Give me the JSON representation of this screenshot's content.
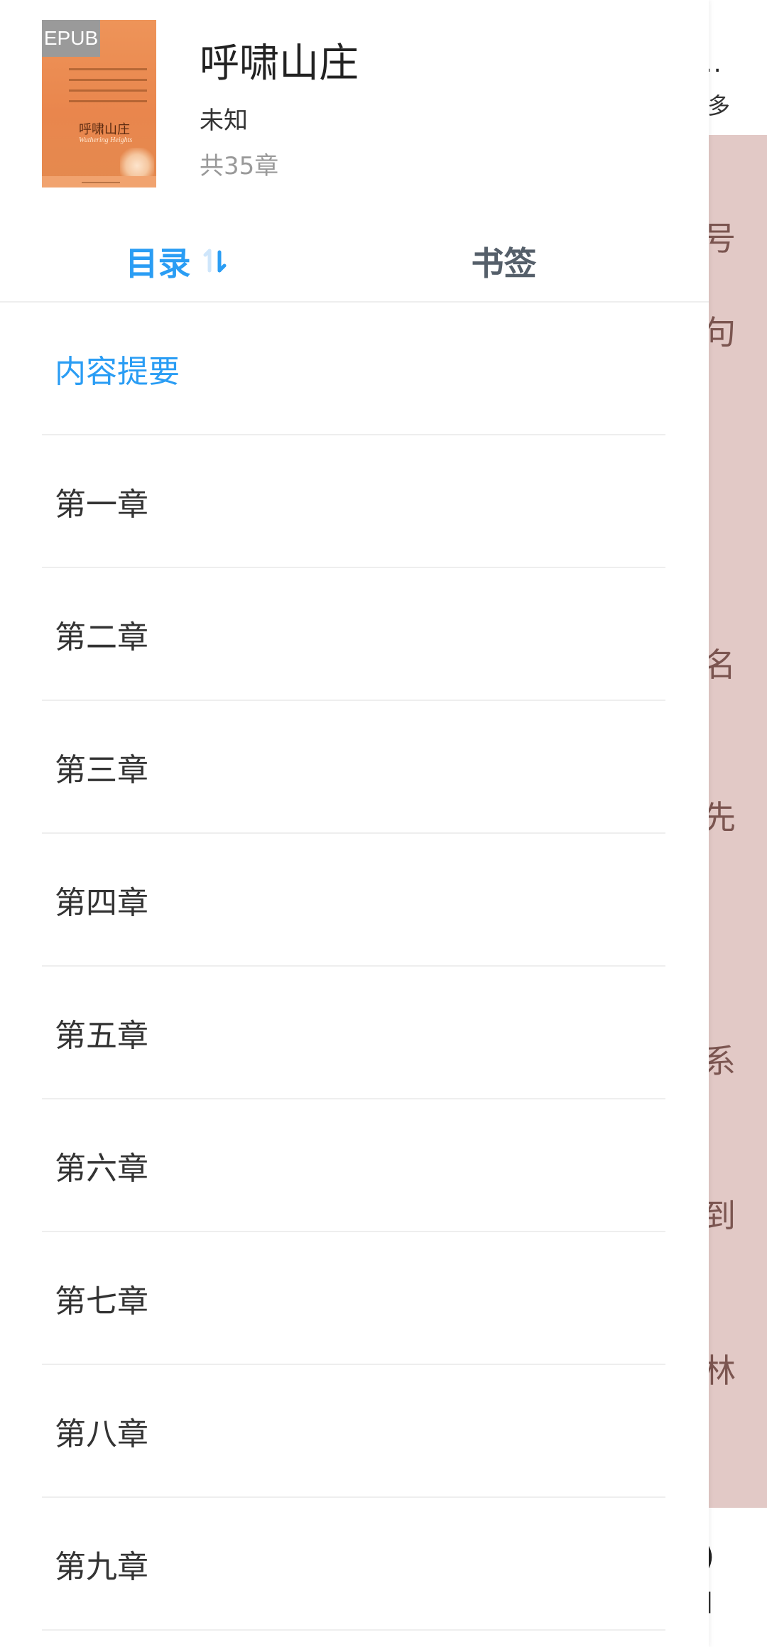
{
  "reader": {
    "more_dots": "..",
    "more_label": "多",
    "peek_chars": [
      "号",
      "句",
      "名",
      "先",
      "系",
      "到",
      "林"
    ],
    "bottom_char_a": ")",
    "bottom_char_b": "]",
    "page_color": "#e2c9c6"
  },
  "book": {
    "cover_badge": "EPUB",
    "cover_title": "呼啸山庄",
    "cover_subtitle": "Wuthering Heights",
    "title": "呼啸山庄",
    "author": "未知",
    "chapter_count": "共35章"
  },
  "tabs": {
    "toc_label": "目录",
    "sort_icon": "sort-order-icon",
    "bookmark_label": "书签",
    "active_color": "#2a9df4"
  },
  "toc": [
    {
      "label": "内容提要",
      "active": true
    },
    {
      "label": "第一章",
      "active": false
    },
    {
      "label": "第二章",
      "active": false
    },
    {
      "label": "第三章",
      "active": false
    },
    {
      "label": "第四章",
      "active": false
    },
    {
      "label": "第五章",
      "active": false
    },
    {
      "label": "第六章",
      "active": false
    },
    {
      "label": "第七章",
      "active": false
    },
    {
      "label": "第八章",
      "active": false
    },
    {
      "label": "第九章",
      "active": false
    }
  ]
}
